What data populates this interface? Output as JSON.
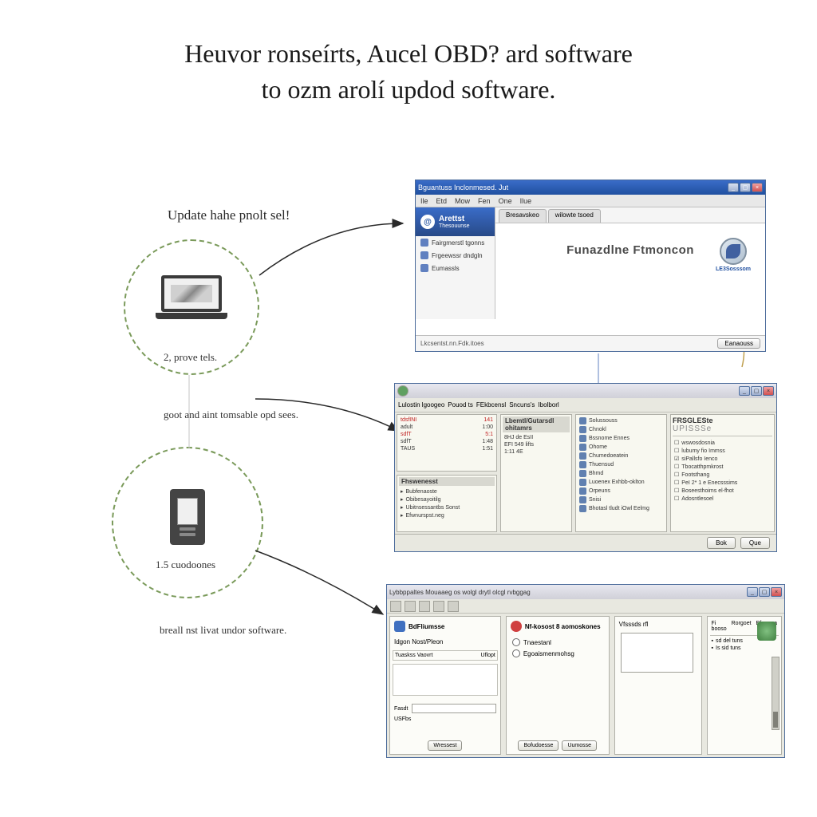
{
  "title_line1": "Heuvor ronseírts, Aucel OBD? ard software",
  "title_line2": "to ozm arolí updod software.",
  "labels": {
    "update_heading": "Update hahe pnolt sel!",
    "step1_caption": "2, prove tels.",
    "step1_subtext": "goot and aint tomsable opd sees.",
    "step2_caption": "1.5 cuodoones",
    "step2_subtext": "breall nst livat undor software."
  },
  "window1": {
    "title": "Bguantuss Inclonmesed. Jut",
    "menu": [
      "Ile",
      "Etd",
      "Mow",
      "Fen",
      "One",
      "Ilue"
    ],
    "brand": "Arettst",
    "brand_sub": "Thesouunse",
    "sidebar_items": [
      "Fairgmerstl tgonns",
      "Frgeewssr dndgln",
      "Eumassls"
    ],
    "tabs": [
      "Bresavskeo",
      "wilowte tsoed"
    ],
    "hero_text": "Funazdlne Ftmoncon",
    "logo_subtext": "LE3Sosssom",
    "status_left": "Lkcsentst.nn.Fdk.itoes",
    "status_btn": "Eanaouss"
  },
  "window2": {
    "toolbar_tabs": [
      "Lulostin lgoogeo",
      "Pouod ts",
      "FEkbcensl",
      "Sncuns's",
      "Ibolborl"
    ],
    "left_rows": [
      [
        "tdsfINI",
        "141"
      ],
      [
        "adult",
        "1:00"
      ],
      [
        "sdfT",
        "5:1"
      ],
      [
        "sdfT",
        "1:48"
      ],
      [
        "TAUS",
        "1:51"
      ]
    ],
    "left_bottom_title": "Fhswenesst",
    "left_bottom_items": [
      "Bubfenaoste",
      "Obibesayoitilg",
      "Ubitnsessantbs Sonst",
      "Efwnurspst.neg"
    ],
    "mid_title": "Lbemtl/Gutarsdl ohitamrs",
    "mid_rows": [
      [
        "8HJ de EsII",
        ""
      ],
      [
        "EFI 549 lifts",
        ""
      ],
      [
        "1:11 4E",
        ""
      ]
    ],
    "mid2_items": [
      "Solussouss",
      "Chnokl",
      "Bssnome Ennes",
      "Ohome",
      "Chumedoeatein",
      "Thuensud",
      "Bhmd",
      "Luoenex Exhbb-oklton",
      "Orpeuns",
      "Snisi",
      "Bhotasl tludt iOwl Eelmg"
    ],
    "right_title": "FRSGLESte",
    "right_sub": "UPISSSe",
    "right_items": [
      "wswosdosnia",
      "lubumy fio Immss",
      "siPallsfo Ienco",
      "Tbocatthpmkrost",
      "Footsthang",
      "PeI 2* 1 e Enecsssims",
      "Boseesthoims el-fhot",
      "Adosntlesoel"
    ],
    "btn_ok": "Bok",
    "btn_cancel": "Que"
  },
  "window3": {
    "title_left": "Lybbppaltes Mouaaeg os wolgl drytl olcgl rvbggag",
    "col1_header": "BdFliumsse",
    "col1_sub": "Idgon Nost/Pleon",
    "col1_table_head": [
      "Tuaskss Vaovrt",
      "Uflopt"
    ],
    "col1_bottom_label": "Fasdt",
    "col1_info": "USFbs",
    "col1_btn1": "Wressest",
    "col2_header": "Nf-kosost 8 aomoskones",
    "col2_radio1": "Tnaestanl",
    "col2_radio2": "Egoaismenmohsg",
    "col2_btn1": "Bofudoesse",
    "col2_btn2": "Uumosse",
    "col3_label": "Vfsssds  rfl",
    "col4_tabs": [
      "Fi booso",
      "Rorgoet",
      "Eformna"
    ],
    "col4_items": [
      "sd del tuns",
      "Is sid tuns"
    ]
  }
}
